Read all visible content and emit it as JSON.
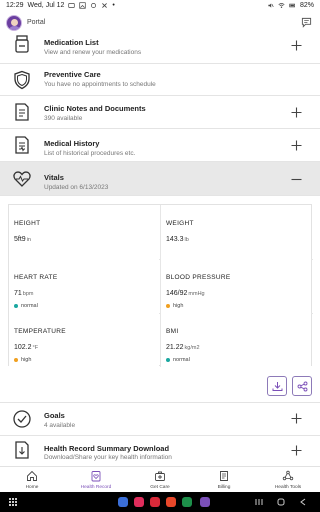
{
  "status": {
    "time": "12:29",
    "date": "Wed, Jul 12",
    "battery": "82%"
  },
  "appbar": {
    "title": "Portal"
  },
  "rows": {
    "medication": {
      "title": "Medication List",
      "subtitle": "View and renew your medications"
    },
    "preventive": {
      "title": "Preventive Care",
      "subtitle": "You have no appointments to schedule"
    },
    "clinic": {
      "title": "Clinic Notes and Documents",
      "subtitle": "390 available"
    },
    "history": {
      "title": "Medical History",
      "subtitle": "List of historical procedures etc."
    },
    "vitals": {
      "title": "Vitals",
      "subtitle": "Updated on 6/13/2023"
    },
    "goals": {
      "title": "Goals",
      "subtitle": "4 available"
    },
    "summary": {
      "title": "Health Record Summary Download",
      "subtitle": "Download/Share your key health information"
    }
  },
  "vitals": {
    "height": {
      "label": "HEIGHT",
      "value": "5ft9",
      "unit": "in"
    },
    "weight": {
      "label": "WEIGHT",
      "value": "143.3",
      "unit": "lb"
    },
    "heart_rate": {
      "label": "HEART RATE",
      "value": "71",
      "unit": "bpm",
      "status": "normal",
      "status_color": "#1aa7a0"
    },
    "blood_pressure": {
      "label": "BLOOD PRESSURE",
      "value": "146/92",
      "unit": "mmHg",
      "status": "high",
      "status_color": "#f0a020"
    },
    "temperature": {
      "label": "TEMPERATURE",
      "value": "102.2",
      "unit": "°F",
      "status": "high",
      "status_color": "#f0a020"
    },
    "bmi": {
      "label": "BMI",
      "value": "21.22",
      "unit": "kg/m2",
      "status": "normal",
      "status_color": "#1aa7a0"
    }
  },
  "bottom_nav": {
    "home": "Home",
    "health_record": "Health Record",
    "get_care": "Get Care",
    "billing": "Billing",
    "health_tools": "Health Tools"
  },
  "colors": {
    "accent": "#7b4fb8",
    "normal": "#1aa7a0",
    "high": "#f0a020"
  }
}
